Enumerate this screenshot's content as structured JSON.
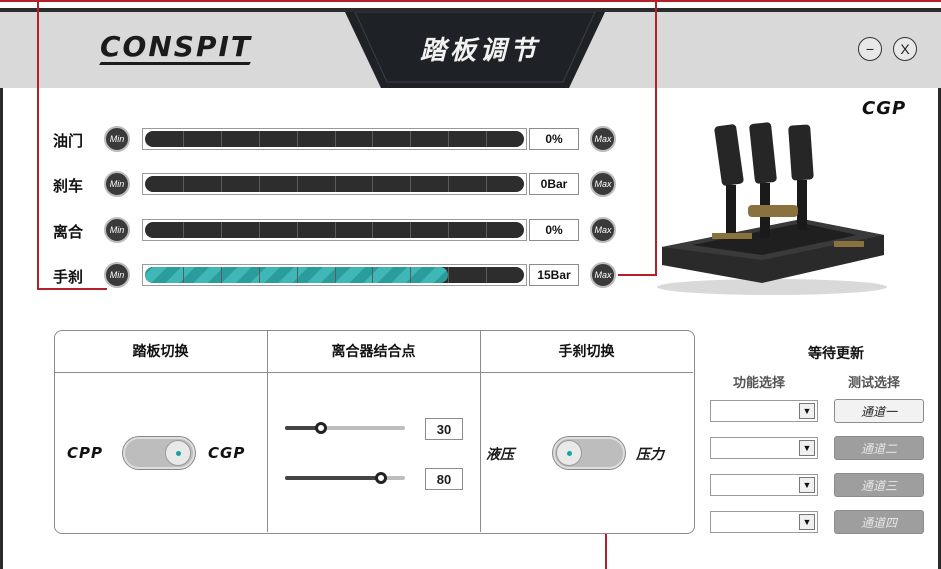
{
  "header": {
    "logo_text": "CONSPIT",
    "title": "踏板调节",
    "minimize_label": "−",
    "close_label": "X"
  },
  "product": {
    "badge_text": "CGP",
    "icon": "pedal-set-image"
  },
  "pedals": [
    {
      "label": "油门",
      "min_label": "Min",
      "max_label": "Max",
      "value": "0%",
      "fill": 0
    },
    {
      "label": "刹车",
      "min_label": "Min",
      "max_label": "Max",
      "value": "0Bar",
      "fill": 0
    },
    {
      "label": "离合",
      "min_label": "Min",
      "max_label": "Max",
      "value": "0%",
      "fill": 0
    },
    {
      "label": "手刹",
      "min_label": "Min",
      "max_label": "Max",
      "value": "15Bar",
      "fill": 0.8
    }
  ],
  "panel": {
    "pedal_switch": {
      "header": "踏板切换",
      "left": "CPP",
      "right": "CGP"
    },
    "clutch_bite": {
      "header": "离合器结合点",
      "slider1_value": "30",
      "slider2_value": "80",
      "slider1": 0.3,
      "slider2": 0.8
    },
    "handbrake_switch": {
      "header": "手刹切换",
      "left": "液压",
      "right": "压力"
    }
  },
  "waiting": {
    "header": "等待更新",
    "function_header": "功能选择",
    "test_header": "测试选择",
    "channels": [
      "通道一",
      "通道二",
      "通道三",
      "通道四"
    ]
  },
  "colors": {
    "accent": "#2a9c9c",
    "annotation": "#b3202a",
    "dark": "#2b2b2b"
  }
}
